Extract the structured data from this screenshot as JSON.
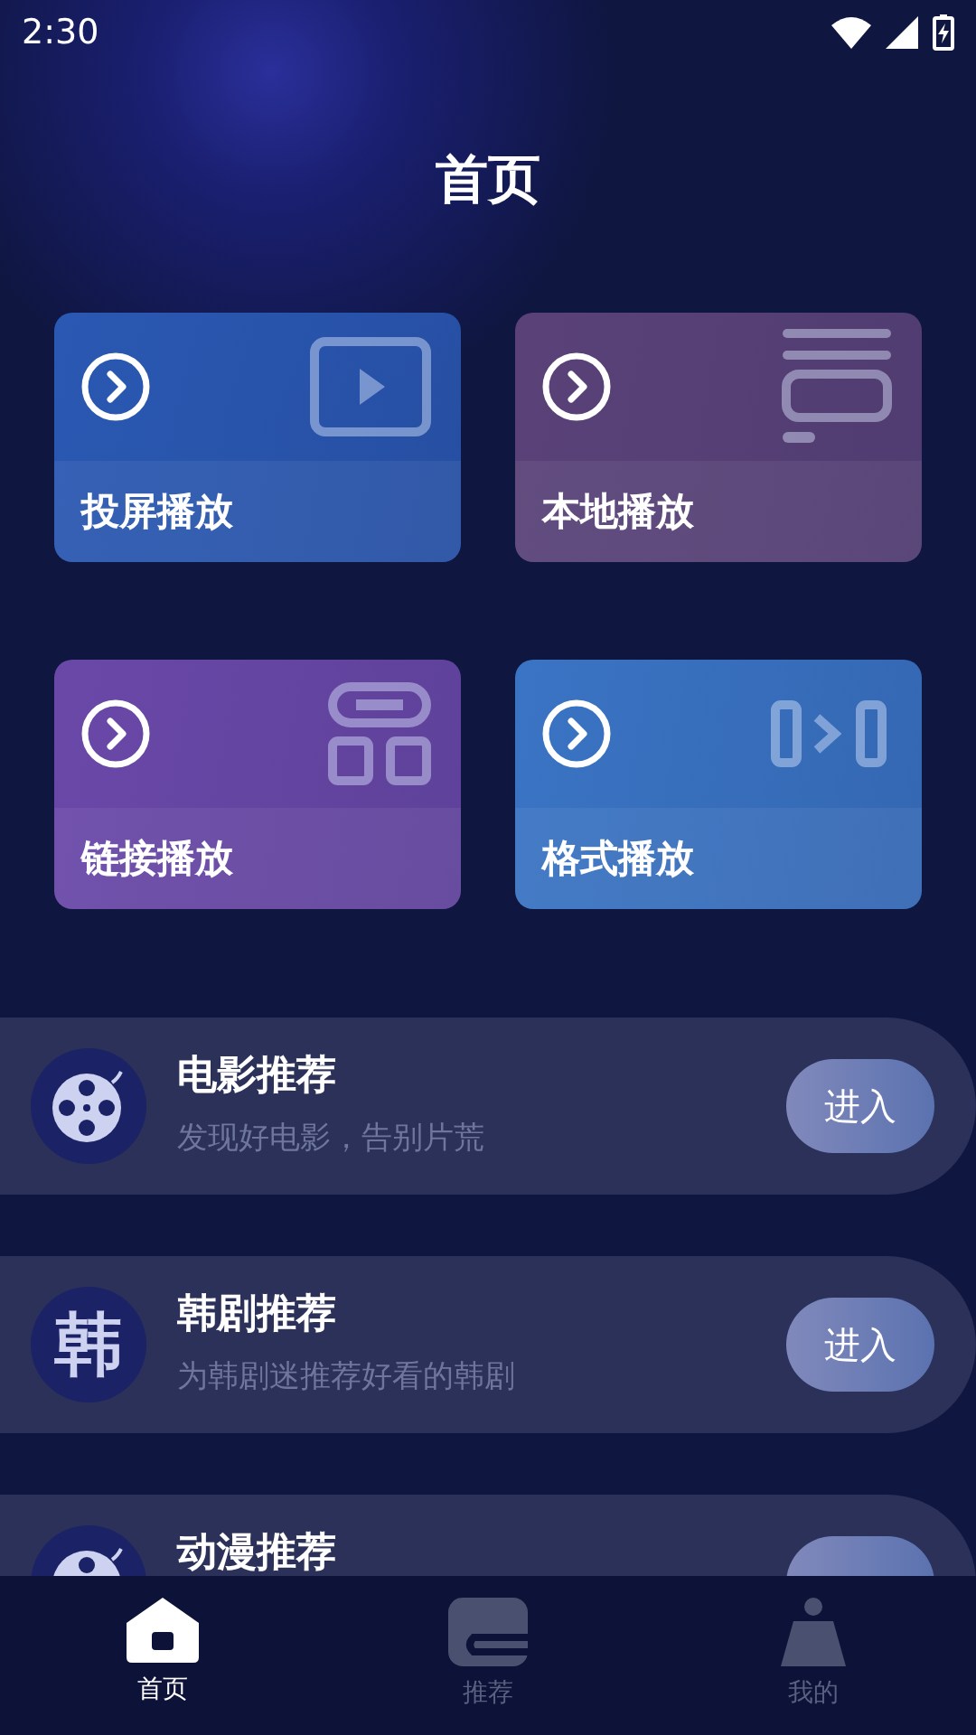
{
  "status_bar": {
    "time": "2:30"
  },
  "title": "首页",
  "cards": [
    {
      "label": "投屏播放",
      "kind": "screen",
      "color": "#2a58b2"
    },
    {
      "label": "本地播放",
      "kind": "local",
      "color": "#5a4278"
    },
    {
      "label": "链接播放",
      "kind": "link",
      "color": "#6a48a8"
    },
    {
      "label": "格式播放",
      "kind": "format",
      "color": "#3a74c4"
    }
  ],
  "recommendations": [
    {
      "title": "电影推荐",
      "subtitle": "发现好电影，告别片荒",
      "icon": {
        "kind": "reel"
      },
      "button": "进入"
    },
    {
      "title": "韩剧推荐",
      "subtitle": "为韩剧迷推荐好看的韩剧",
      "icon": {
        "kind": "text",
        "text": "韩"
      },
      "button": "进入"
    },
    {
      "title": "动漫推荐",
      "icon": {
        "kind": "reel"
      }
    }
  ],
  "bottom_nav": [
    {
      "label": "首页",
      "kind": "home",
      "selected": true
    },
    {
      "label": "推荐",
      "kind": "recommend",
      "selected": false
    },
    {
      "label": "我的",
      "kind": "person",
      "selected": false
    }
  ]
}
